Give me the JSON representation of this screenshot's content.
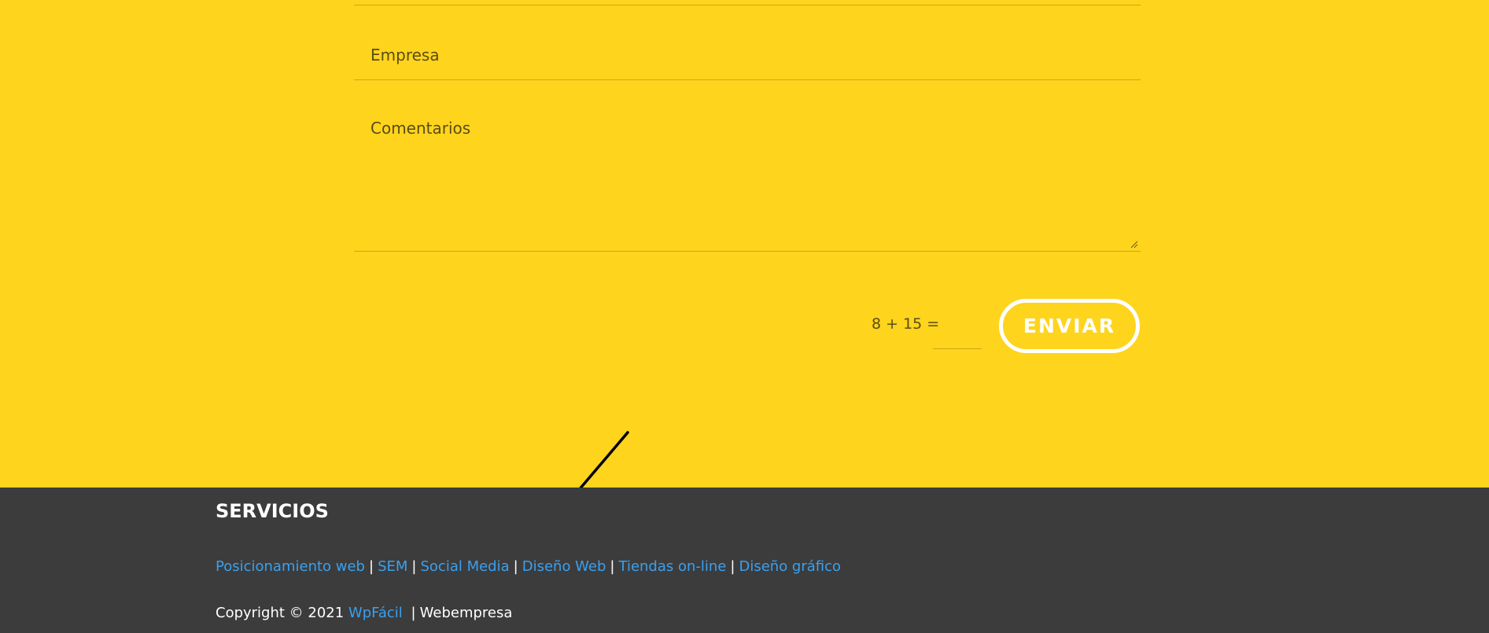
{
  "form": {
    "empresa_placeholder": "Empresa",
    "comentarios_placeholder": "Comentarios",
    "captcha_label": "8 + 15 =",
    "captcha_value": "",
    "submit_label": "ENVIAR"
  },
  "footer": {
    "title": "SERVICIOS",
    "separator": "|",
    "links": [
      {
        "label": "Posicionamiento web"
      },
      {
        "label": "SEM"
      },
      {
        "label": "Social Media"
      },
      {
        "label": "Diseño Web"
      },
      {
        "label": "Tiendas on-line"
      },
      {
        "label": "Diseño gráfico"
      }
    ],
    "copyright_prefix": "Copyright © 2021",
    "copyright_link": "WpFácil",
    "copyright_suffix": "Webempresa"
  },
  "colors": {
    "background_yellow": "#fed41d",
    "footer_background": "#3c3c3c",
    "link_blue": "#3aa0ef",
    "button_white": "#ffffff"
  },
  "icons": {
    "annotation": "arrow-icon"
  }
}
